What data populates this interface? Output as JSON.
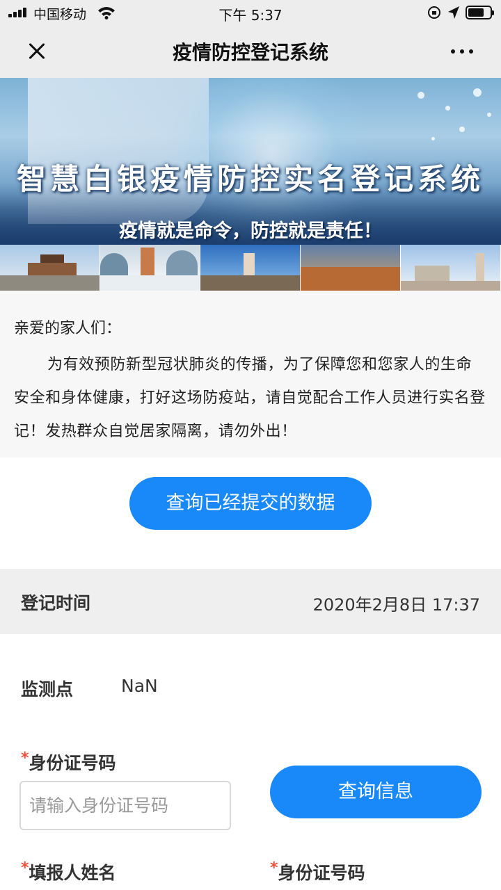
{
  "status_bar": {
    "carrier": "中国移动",
    "time": "下午 5:37"
  },
  "nav": {
    "title": "疫情防控登记系统"
  },
  "banner": {
    "title": "智慧白银疫情防控实名登记系统",
    "slogan": "疫情就是命令，防控就是责任！"
  },
  "notice": {
    "greeting": "亲爱的家人们：",
    "body": "为有效预防新型冠状肺炎的传播，为了保障您和您家人的生命安全和身体健康，打好这场防疫站，请自觉配合工作人员进行实名登记！发热群众自觉居家隔离，请勿外出！"
  },
  "query_data_button": "查询已经提交的数据",
  "time_row": {
    "label": "登记时间",
    "value": "2020年2月8日 17:37"
  },
  "monitor": {
    "label": "监测点",
    "value": "NaN"
  },
  "id_field": {
    "required_mark": "*",
    "label": "身份证号码",
    "placeholder": "请输入身份证号码",
    "value": ""
  },
  "query_info_button": "查询信息",
  "reporter_name": {
    "required_mark": "*",
    "label": "填报人姓名"
  },
  "reporter_id": {
    "required_mark": "*",
    "label": "身份证号码"
  }
}
